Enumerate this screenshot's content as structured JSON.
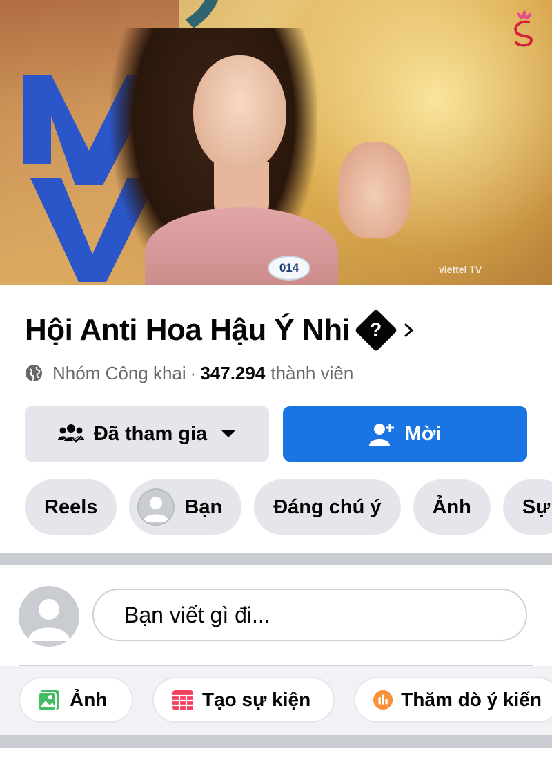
{
  "cover": {
    "contestant_number": "014",
    "watermark": "viettel TV",
    "logo_icon": "flower-s-logo-icon"
  },
  "group": {
    "title": "Hội Anti Hoa Hậu Ý Nhi",
    "title_badge": "?",
    "privacy": "Nhóm Công khai",
    "separator": "·",
    "member_count": "347.294",
    "member_label": "thành viên"
  },
  "buttons": {
    "joined_label": "Đã tham gia",
    "invite_label": "Mời"
  },
  "tabs": [
    {
      "label": "Reels"
    },
    {
      "label": "Bạn"
    },
    {
      "label": "Đáng chú ý"
    },
    {
      "label": "Ảnh"
    },
    {
      "label": "Sự"
    }
  ],
  "composer": {
    "placeholder": "Bạn viết gì đi..."
  },
  "actions": [
    {
      "label": "Ảnh",
      "icon": "photo-icon",
      "color": "#45bd62"
    },
    {
      "label": "Tạo sự kiện",
      "icon": "calendar-icon",
      "color": "#f3425f"
    },
    {
      "label": "Thăm dò ý kiến",
      "icon": "poll-icon",
      "color": "#f7b928"
    }
  ],
  "colors": {
    "accent": "#1b74e4",
    "chip_bg": "#e4e6eb",
    "secondary_text": "#65676b"
  }
}
